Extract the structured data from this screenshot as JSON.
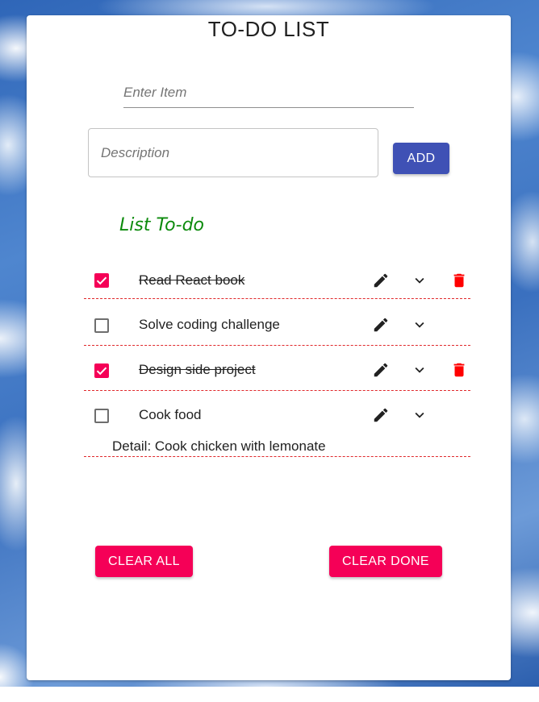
{
  "app": {
    "title": "TO-DO LIST"
  },
  "form": {
    "item_placeholder": "Enter Item",
    "description_placeholder": "Description",
    "add_label": "ADD"
  },
  "list": {
    "heading": "List To-do",
    "items": [
      {
        "label": "Read React book",
        "done": true
      },
      {
        "label": "Solve coding challenge",
        "done": false
      },
      {
        "label": "Design side project",
        "done": true
      },
      {
        "label": "Cook food",
        "done": false,
        "detail": "Detail: Cook chicken with lemonate"
      }
    ]
  },
  "actions": {
    "clear_all_label": "CLEAR ALL",
    "clear_done_label": "CLEAR DONE"
  },
  "colors": {
    "primary": "#3f51b5",
    "secondary": "#f50057",
    "delete": "#ff0000",
    "heading": "#0b8a0b",
    "divider": "#e0282b"
  },
  "icons": {
    "edit": "pencil-icon",
    "expand": "chevron-down-icon",
    "delete": "trash-icon",
    "check": "checkmark-icon"
  }
}
